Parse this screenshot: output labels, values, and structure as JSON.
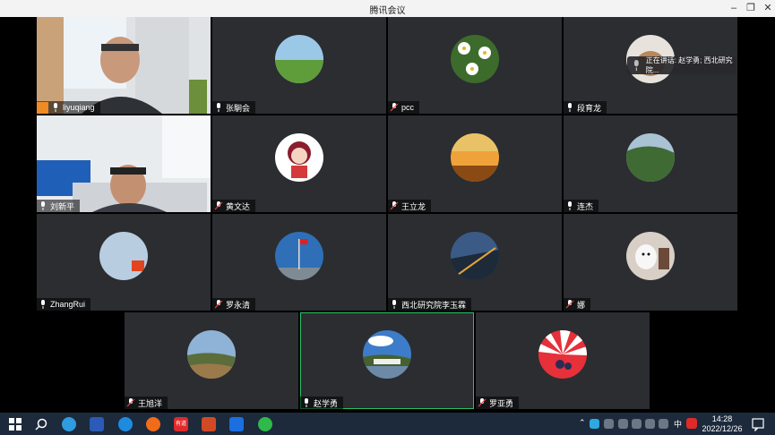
{
  "window": {
    "title": "腾讯会议"
  },
  "speaking": {
    "label": "正在讲话: 赵学勇; 西北研究院..."
  },
  "participants": [
    {
      "name": "liyuqiang"
    },
    {
      "name": "张駉会"
    },
    {
      "name": "pcc"
    },
    {
      "name": "段育龙"
    },
    {
      "name": "刘新平"
    },
    {
      "name": "黄文达"
    },
    {
      "name": "王立龙"
    },
    {
      "name": "连杰"
    },
    {
      "name": "ZhangRui"
    },
    {
      "name": "罗永清"
    },
    {
      "name": "西北研究院李玉霖"
    },
    {
      "name": "娜"
    },
    {
      "name": "王旭洋"
    },
    {
      "name": "赵学勇"
    },
    {
      "name": "罗亚勇"
    }
  ],
  "taskbar": {
    "time": "14:28",
    "date": "2022/12/26",
    "ime": "中",
    "app_badge": "有道"
  },
  "colors": {
    "tile": "#2b2d31",
    "active_border": "#27c266",
    "taskbar": "#1c2a3c",
    "host_badge": "#f08a24"
  }
}
